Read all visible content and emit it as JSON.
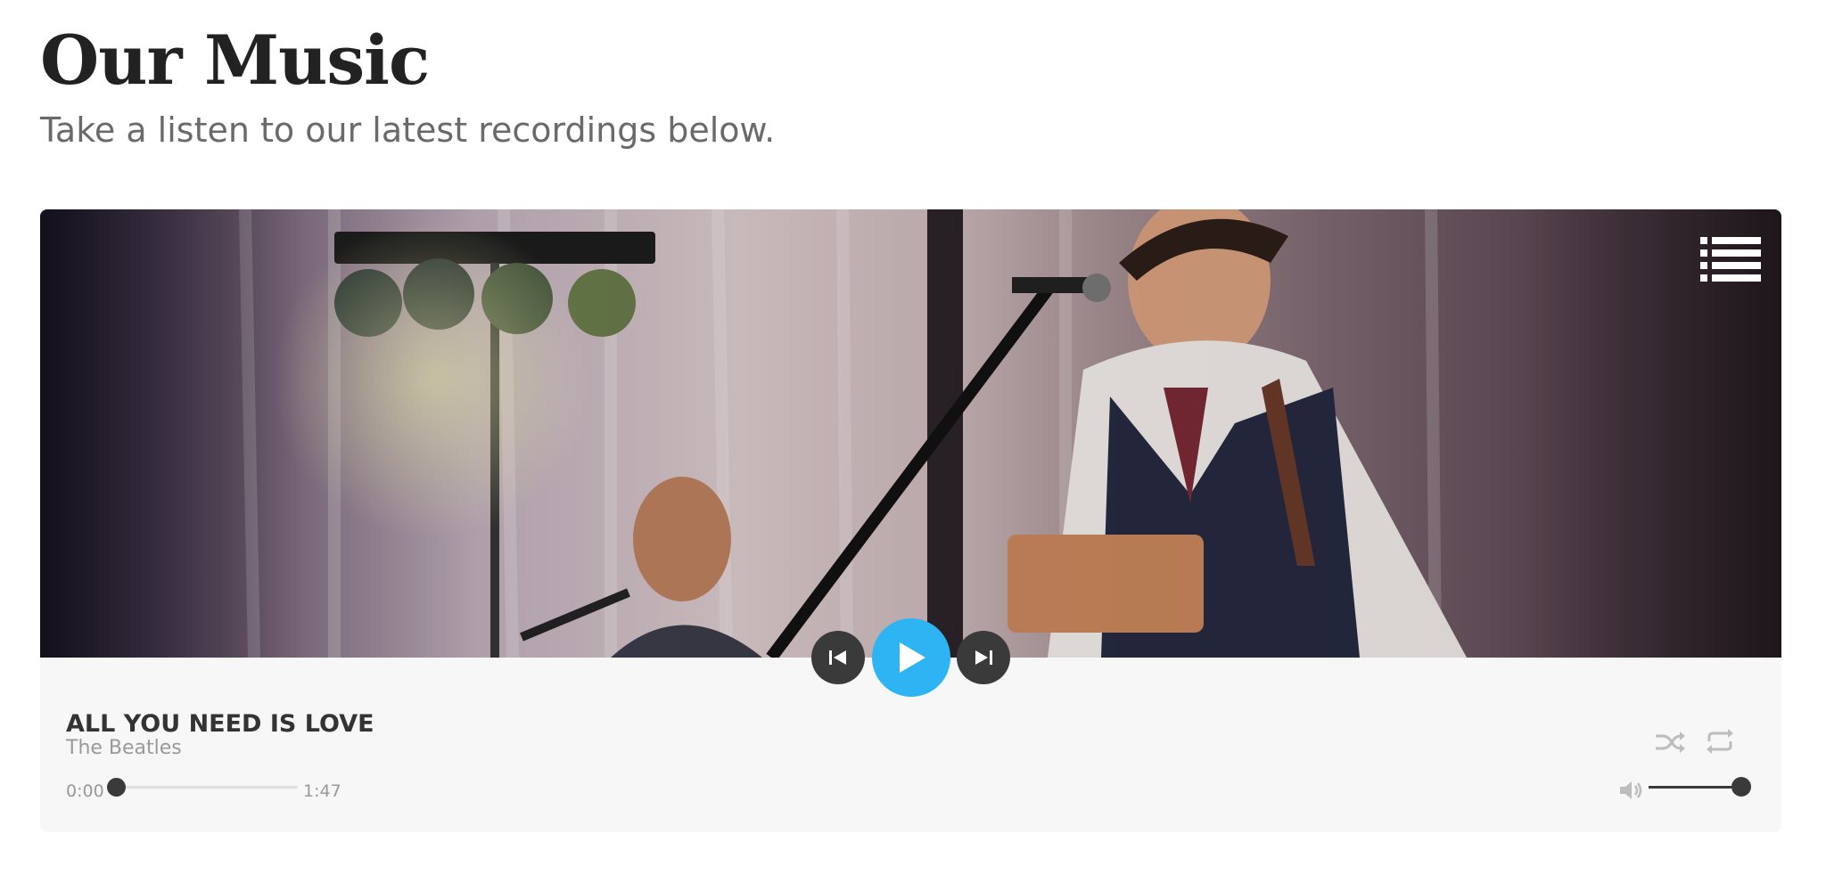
{
  "header": {
    "title": "Our Music",
    "subtitle": "Take a listen to our latest recordings below."
  },
  "player": {
    "cover_image": "band-performing-photo",
    "playlist_icon": "playlist-icon",
    "controls": {
      "prev_icon": "skip-previous-icon",
      "play_icon": "play-icon",
      "next_icon": "skip-next-icon",
      "accent_color": "#2eb4f3"
    },
    "track": {
      "title": "ALL YOU NEED IS LOVE",
      "artist": "The Beatles",
      "current_time": "0:00",
      "duration": "1:47",
      "progress": 0.0
    },
    "shuffle_icon": "shuffle-icon",
    "repeat_icon": "repeat-icon",
    "volume_icon": "volume-icon",
    "volume": 1.0
  }
}
